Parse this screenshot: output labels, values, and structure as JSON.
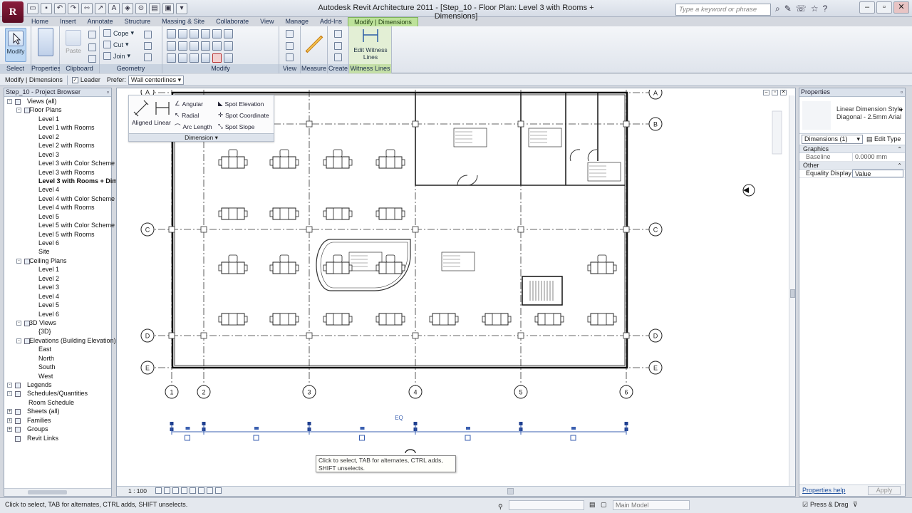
{
  "window": {
    "title": "Autodesk Revit Architecture 2011 - [Step_10 - Floor Plan: Level 3 with Rooms + Dimensions]",
    "app_letter": "R"
  },
  "search": {
    "placeholder": "Type a keyword or phrase"
  },
  "tabs": [
    "Home",
    "Insert",
    "Annotate",
    "Structure",
    "Massing & Site",
    "Collaborate",
    "View",
    "Manage",
    "Add-Ins",
    "Modify | Dimensions"
  ],
  "ribbon": {
    "modify_label": "Modify",
    "paste_label": "Paste",
    "cope_label": "Cope",
    "cut_label": "Cut",
    "join_label": "Join",
    "edit_witness_label": "Edit Witness Lines",
    "panels": {
      "select": "Select",
      "properties": "Properties",
      "clipboard": "Clipboard",
      "geometry": "Geometry",
      "modify": "Modify",
      "view": "View",
      "measure": "Measure",
      "create": "Create",
      "witness": "Witness Lines"
    }
  },
  "options_bar": {
    "context": "Modify | Dimensions",
    "leader_label": "Leader",
    "prefer_label": "Prefer:",
    "prefer_value": "Wall centerlines"
  },
  "project_browser": {
    "title": "Step_10 - Project Browser",
    "items": [
      {
        "label": "Views (all)",
        "level": 0,
        "exp": "-"
      },
      {
        "label": "Floor Plans",
        "level": 1,
        "exp": "-"
      },
      {
        "label": "Level 1",
        "level": 2
      },
      {
        "label": "Level 1 with Rooms",
        "level": 2
      },
      {
        "label": "Level 2",
        "level": 2
      },
      {
        "label": "Level 2 with Rooms",
        "level": 2
      },
      {
        "label": "Level 3",
        "level": 2
      },
      {
        "label": "Level 3 with Color Scheme",
        "level": 2
      },
      {
        "label": "Level 3 with Rooms",
        "level": 2
      },
      {
        "label": "Level 3 with Rooms + Dim",
        "level": 2,
        "bold": true
      },
      {
        "label": "Level 4",
        "level": 2
      },
      {
        "label": "Level 4 with Color Scheme",
        "level": 2
      },
      {
        "label": "Level 4 with Rooms",
        "level": 2
      },
      {
        "label": "Level 5",
        "level": 2
      },
      {
        "label": "Level 5 with Color Scheme",
        "level": 2
      },
      {
        "label": "Level 5 with Rooms",
        "level": 2
      },
      {
        "label": "Level 6",
        "level": 2
      },
      {
        "label": "Site",
        "level": 2
      },
      {
        "label": "Ceiling Plans",
        "level": 1,
        "exp": "-"
      },
      {
        "label": "Level 1",
        "level": 2
      },
      {
        "label": "Level 2",
        "level": 2
      },
      {
        "label": "Level 3",
        "level": 2
      },
      {
        "label": "Level 4",
        "level": 2
      },
      {
        "label": "Level 5",
        "level": 2
      },
      {
        "label": "Level 6",
        "level": 2
      },
      {
        "label": "3D Views",
        "level": 1,
        "exp": "-"
      },
      {
        "label": "{3D}",
        "level": 2
      },
      {
        "label": "Elevations (Building Elevation)",
        "level": 1,
        "exp": "-"
      },
      {
        "label": "East",
        "level": 2
      },
      {
        "label": "North",
        "level": 2
      },
      {
        "label": "South",
        "level": 2
      },
      {
        "label": "West",
        "level": 2
      },
      {
        "label": "Legends",
        "level": 0,
        "exp": "-",
        "icon": true
      },
      {
        "label": "Schedules/Quantities",
        "level": 0,
        "exp": "-",
        "icon": true
      },
      {
        "label": "Room Schedule",
        "level": 1
      },
      {
        "label": "Sheets (all)",
        "level": 0,
        "exp": "+",
        "icon": true
      },
      {
        "label": "Families",
        "level": 0,
        "exp": "+",
        "icon": true
      },
      {
        "label": "Groups",
        "level": 0,
        "exp": "+",
        "icon": true
      },
      {
        "label": "Revit Links",
        "level": 0,
        "icon": true
      }
    ]
  },
  "dimension_panel": {
    "aligned": "Aligned",
    "linear": "Linear",
    "angular": "Angular",
    "radial": "Radial",
    "arc_length": "Arc Length",
    "spot_elevation": "Spot Elevation",
    "spot_coordinate": "Spot Coordinate",
    "spot_slope": "Spot Slope",
    "footer": "Dimension"
  },
  "drawing": {
    "grid_rows": [
      "A",
      "B",
      "C",
      "D",
      "E"
    ],
    "grid_cols": [
      "1",
      "2",
      "3",
      "4",
      "5",
      "6"
    ],
    "eq_label": "EQ",
    "tooltip": "Click to select, TAB for alternates, CTRL adds, SHIFT unselects."
  },
  "view_bar": {
    "scale": "1 : 100"
  },
  "properties": {
    "title": "Properties",
    "type_name": "Linear Dimension Style",
    "type_detail": "Diagonal - 2.5mm Arial",
    "instance": "Dimensions (1)",
    "edit_type": "Edit Type",
    "categories": [
      {
        "name": "Graphics",
        "rows": [
          {
            "key": "Baseline Offset...",
            "value": "0.0000 mm"
          }
        ]
      },
      {
        "name": "Other",
        "rows": [
          {
            "key": "Equality Display",
            "value": "Value"
          }
        ]
      }
    ],
    "help_link": "Properties help",
    "apply": "Apply"
  },
  "status": {
    "message": "Click to select, TAB for alternates, CTRL adds, SHIFT unselects.",
    "model": "Main Model",
    "press_drag": "Press & Drag"
  }
}
